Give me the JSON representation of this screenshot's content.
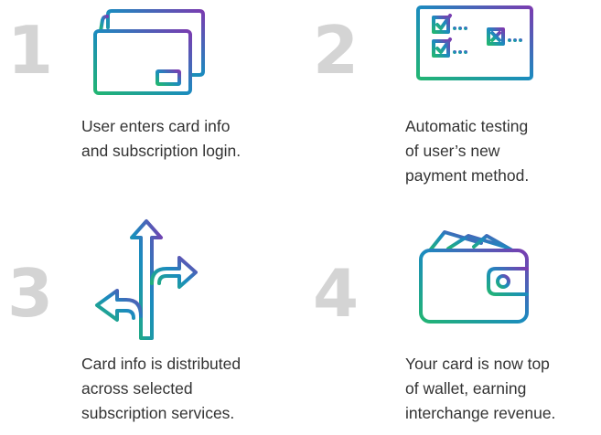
{
  "steps": [
    {
      "number": "1",
      "icon": "credit-card-icon",
      "caption_lines": [
        "User enters card info",
        "and subscription login."
      ]
    },
    {
      "number": "2",
      "icon": "monitor-checklist-icon",
      "caption_lines": [
        "Automatic testing",
        "of user’s new",
        "payment method."
      ]
    },
    {
      "number": "3",
      "icon": "branching-arrows-icon",
      "caption_lines": [
        "Card info is distributed",
        "across selected",
        "subscription services."
      ]
    },
    {
      "number": "4",
      "icon": "wallet-icon",
      "caption_lines": [
        "Your card is now top",
        "of wallet, earning",
        "interchange revenue."
      ]
    }
  ],
  "colors": {
    "gradient_start": "#22b573",
    "gradient_mid": "#1b8bbf",
    "gradient_end": "#7a3cb0",
    "number": "#d4d4d4",
    "text": "#333333"
  }
}
